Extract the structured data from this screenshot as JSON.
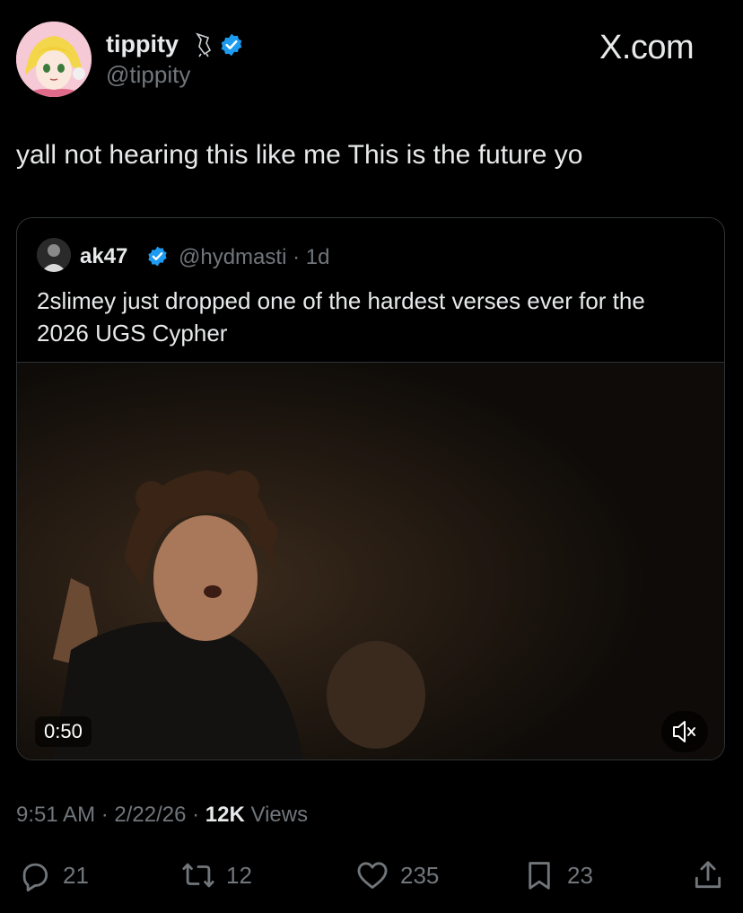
{
  "author": {
    "display_name": "tippity",
    "handle": "@tippity",
    "badge_icon": "bird-emoji-icon",
    "verified": true
  },
  "brand": "X.com",
  "tweet": {
    "text": "yall not hearing this like me This is the future yo"
  },
  "quote": {
    "display_name": "ak47",
    "handle_time": "@hydmasti · 1d",
    "text": "2slimey just dropped one of the hardest verses ever for the 2026 UGS Cypher",
    "video": {
      "duration": "0:50",
      "muted": true
    }
  },
  "meta": {
    "time_date": "9:51 AM · 2/22/26 · ",
    "views_count": "12K",
    "views_label": " Views"
  },
  "actions": {
    "replies": "21",
    "reposts": "12",
    "likes": "235",
    "bookmarks": "23"
  },
  "colors": {
    "background": "#000000",
    "text": "#e7e9ea",
    "secondary": "#71767b",
    "verified": "#1d9bf0",
    "border": "#2f3336"
  }
}
